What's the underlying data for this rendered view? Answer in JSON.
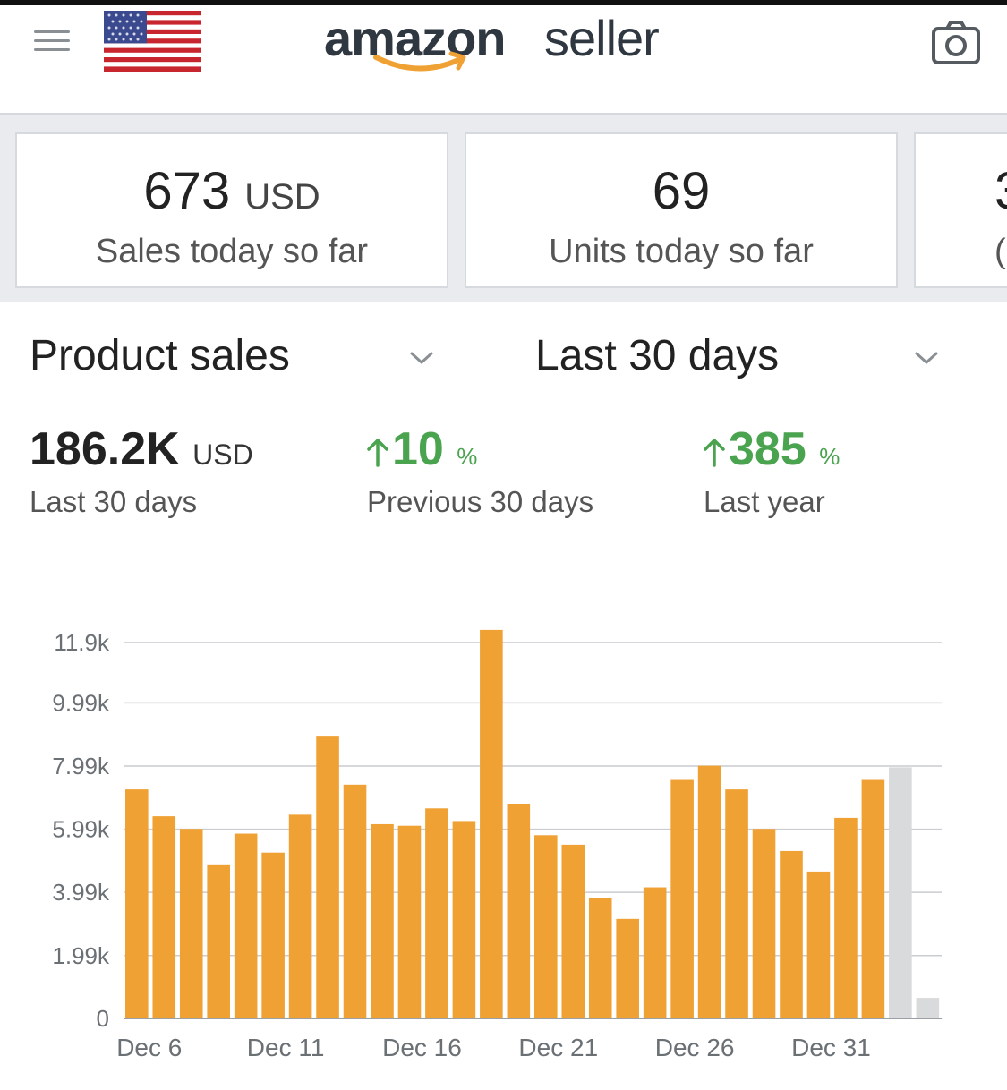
{
  "header": {
    "logo_word1": "amazon",
    "logo_word2": "seller",
    "menu_icon": "hamburger-menu-icon",
    "flag_icon": "us-flag-icon",
    "camera_icon": "camera-icon"
  },
  "cards": [
    {
      "value": "673",
      "unit": "USD",
      "label": "Sales today so far"
    },
    {
      "value": "69",
      "unit": "",
      "label": "Units today so far"
    },
    {
      "value": "3",
      "unit": "",
      "label": "("
    }
  ],
  "selectors": {
    "metric": "Product sales",
    "range": "Last 30 days"
  },
  "stats": {
    "total": {
      "value": "186.2K",
      "unit": "USD",
      "label": "Last 30 days"
    },
    "prev": {
      "value": "10",
      "unit": "%",
      "label": "Previous 30 days"
    },
    "year": {
      "value": "385",
      "unit": "%",
      "label": "Last year"
    }
  },
  "colors": {
    "bar": "#f0a134",
    "bar_today": "#d9dadc",
    "positive": "#4aa34e",
    "text": "#222222"
  },
  "chart_data": {
    "type": "bar",
    "y_ticks": [
      "0",
      "1.99k",
      "3.99k",
      "5.99k",
      "7.99k",
      "9.99k",
      "11.9k"
    ],
    "y_tick_values": [
      0,
      1990,
      3990,
      5990,
      7990,
      9990,
      11900
    ],
    "ylim": [
      0,
      11900
    ],
    "x_tick_labels": [
      "Dec 6",
      "Dec 11",
      "Dec 16",
      "Dec 21",
      "Dec 26",
      "Dec 31"
    ],
    "categories": [
      "Dec 6",
      "Dec 7",
      "Dec 8",
      "Dec 9",
      "Dec 10",
      "Dec 11",
      "Dec 12",
      "Dec 13",
      "Dec 14",
      "Dec 15",
      "Dec 16",
      "Dec 17",
      "Dec 18",
      "Dec 19",
      "Dec 20",
      "Dec 21",
      "Dec 22",
      "Dec 23",
      "Dec 24",
      "Dec 25",
      "Dec 26",
      "Dec 27",
      "Dec 28",
      "Dec 29",
      "Dec 30",
      "Dec 31",
      "Jan 1",
      "Jan 2",
      "Jan 3",
      "Jan 4"
    ],
    "values": [
      7250,
      6400,
      6000,
      4850,
      5850,
      5250,
      6450,
      8950,
      7400,
      6150,
      6100,
      6650,
      6250,
      12300,
      6800,
      5800,
      5500,
      3800,
      3150,
      4150,
      7550,
      8000,
      7250,
      6000,
      5300,
      4650,
      6350,
      7550,
      7950,
      650
    ],
    "today_indices": [
      28,
      29
    ],
    "grid": true
  }
}
